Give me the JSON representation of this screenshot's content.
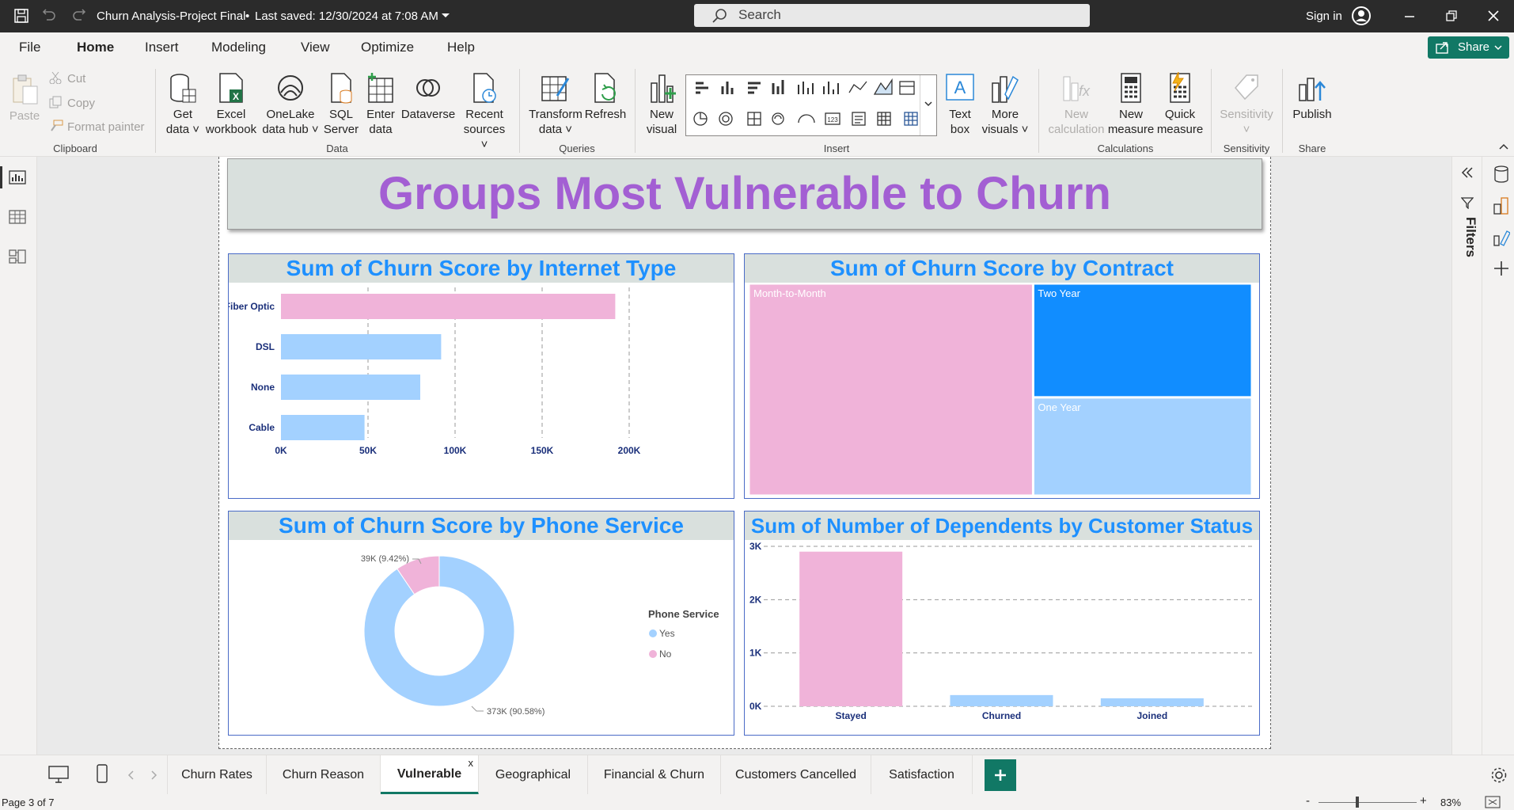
{
  "titlebar": {
    "doc_title": "Churn Analysis-Project Final",
    "saved_status": "Last saved: 12/30/2024 at 7:08 AM",
    "search_placeholder": "Search",
    "sign_in": "Sign in"
  },
  "menu": {
    "items": [
      "File",
      "Home",
      "Insert",
      "Modeling",
      "View",
      "Optimize",
      "Help"
    ],
    "active": "Home",
    "share": "Share"
  },
  "ribbon": {
    "clipboard": {
      "paste": "Paste",
      "cut": "Cut",
      "copy": "Copy",
      "format_painter": "Format painter",
      "group": "Clipboard"
    },
    "data": {
      "get_data": [
        "Get",
        "data"
      ],
      "excel": [
        "Excel",
        "workbook"
      ],
      "onelake": [
        "OneLake",
        "data hub"
      ],
      "sql": [
        "SQL",
        "Server"
      ],
      "enter": [
        "Enter",
        "data"
      ],
      "dataverse": "Dataverse",
      "recent": [
        "Recent",
        "sources"
      ],
      "group": "Data"
    },
    "queries": {
      "transform": [
        "Transform",
        "data"
      ],
      "refresh": "Refresh",
      "group": "Queries"
    },
    "insert": {
      "new_visual": [
        "New",
        "visual"
      ],
      "text_box": [
        "Text",
        "box"
      ],
      "more_visuals": [
        "More",
        "visuals"
      ],
      "group": "Insert"
    },
    "calculations": {
      "new_calc": [
        "New",
        "calculation"
      ],
      "new_measure": [
        "New",
        "measure"
      ],
      "quick_measure": [
        "Quick",
        "measure"
      ],
      "group": "Calculations"
    },
    "sensitivity": {
      "label": "Sensitivity",
      "group": "Sensitivity"
    },
    "share": {
      "publish": "Publish",
      "group": "Share"
    }
  },
  "report": {
    "banner_title": "Groups Most Vulnerable to Churn"
  },
  "right_panel": {
    "filters": "Filters"
  },
  "tabs": {
    "items": [
      "Churn Rates",
      "Churn Reason",
      "Vulnerable",
      "Geographical",
      "Financial & Churn",
      "Customers Cancelled",
      "Satisfaction"
    ],
    "active": "Vulnerable",
    "close_mark": "x"
  },
  "status": {
    "page": "Page 3 of 7",
    "zoom": "83%"
  },
  "colors": {
    "pink": "#f0b3d9",
    "light_blue": "#a3d1ff",
    "blue": "#118dff",
    "title_blue": "#1e90ff",
    "banner_purple": "#a35fd3"
  },
  "chart_data": [
    {
      "type": "bar",
      "orientation": "horizontal",
      "title": "Sum of Churn Score by Internet Type",
      "categories": [
        "Fiber Optic",
        "DSL",
        "None",
        "Cable"
      ],
      "values": [
        192000,
        92000,
        80000,
        48000
      ],
      "tick_labels": [
        "0K",
        "50K",
        "100K",
        "150K",
        "200K"
      ],
      "xlim": [
        0,
        200000
      ],
      "colors": [
        "#f0b3d9",
        "#a3d1ff",
        "#a3d1ff",
        "#a3d1ff"
      ]
    },
    {
      "type": "treemap",
      "title": "Sum of Churn Score by Contract",
      "categories": [
        "Month-to-Month",
        "Two Year",
        "One Year"
      ],
      "values": [
        230,
        95,
        82
      ],
      "colors": [
        "#f0b3d9",
        "#118dff",
        "#a3d1ff"
      ]
    },
    {
      "type": "pie",
      "variant": "donut",
      "title": "Sum of Churn Score by Phone Service",
      "legend_title": "Phone Service",
      "categories": [
        "Yes",
        "No"
      ],
      "values": [
        373,
        39
      ],
      "data_labels": [
        "373K (90.58%)",
        "39K (9.42%)"
      ],
      "colors": [
        "#a3d1ff",
        "#f0b3d9"
      ],
      "legend_position": "right"
    },
    {
      "type": "bar",
      "title": "Sum of Number of Dependents by Customer Status",
      "categories": [
        "Stayed",
        "Churned",
        "Joined"
      ],
      "values": [
        2900,
        210,
        150
      ],
      "tick_labels": [
        "0K",
        "1K",
        "2K",
        "3K"
      ],
      "ylim": [
        0,
        3000
      ],
      "colors": [
        "#f0b3d9",
        "#a3d1ff",
        "#a3d1ff"
      ]
    }
  ]
}
